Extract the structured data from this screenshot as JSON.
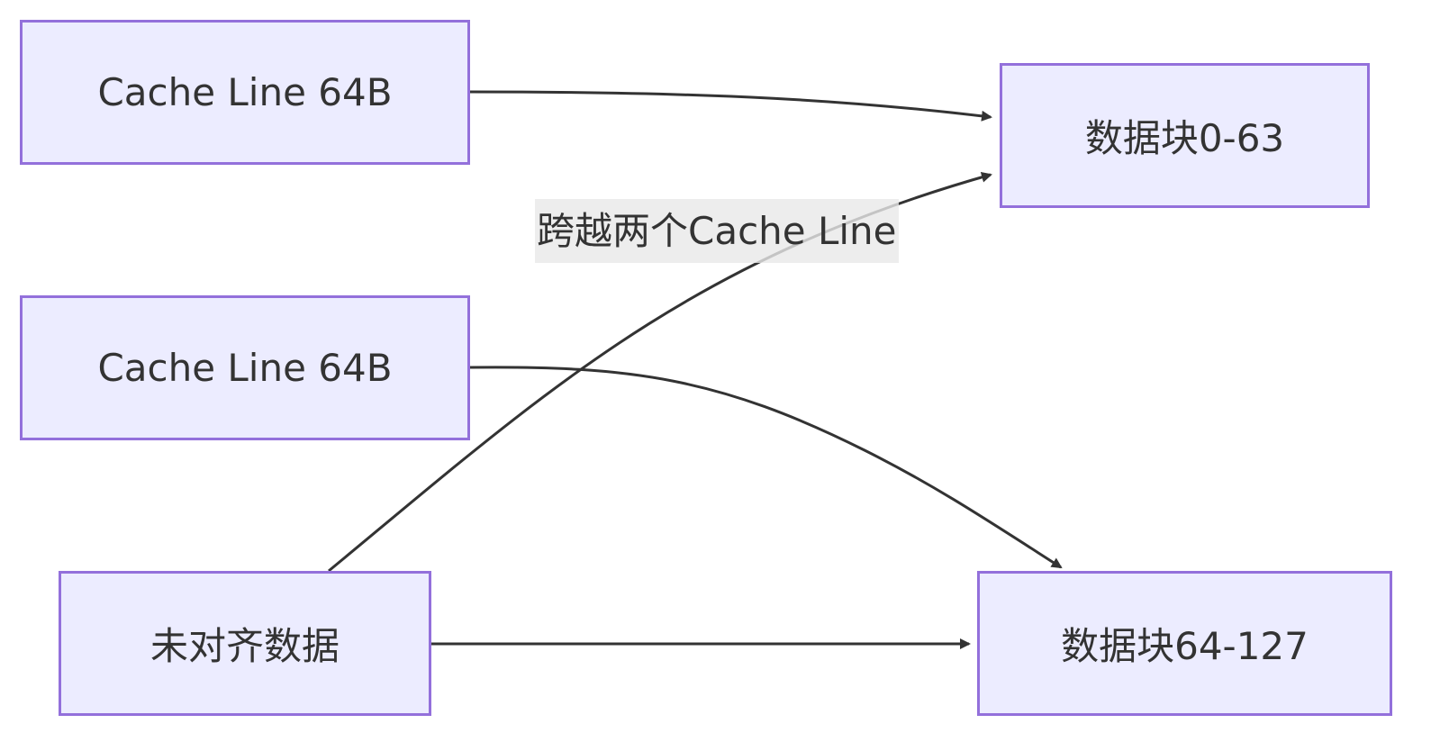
{
  "nodes": {
    "cache_line_1": "Cache Line 64B",
    "cache_line_2": "Cache Line 64B",
    "unaligned_data": "未对齐数据",
    "block_0_63": "数据块0-63",
    "block_64_127": "数据块64-127"
  },
  "edges": {
    "unaligned_to_block0_label": "跨越两个Cache Line"
  },
  "colors": {
    "node_fill": "#ececff",
    "node_border": "#9370db",
    "edge": "#333333",
    "text": "#333333",
    "edge_label_bg": "#e8e8e8"
  }
}
